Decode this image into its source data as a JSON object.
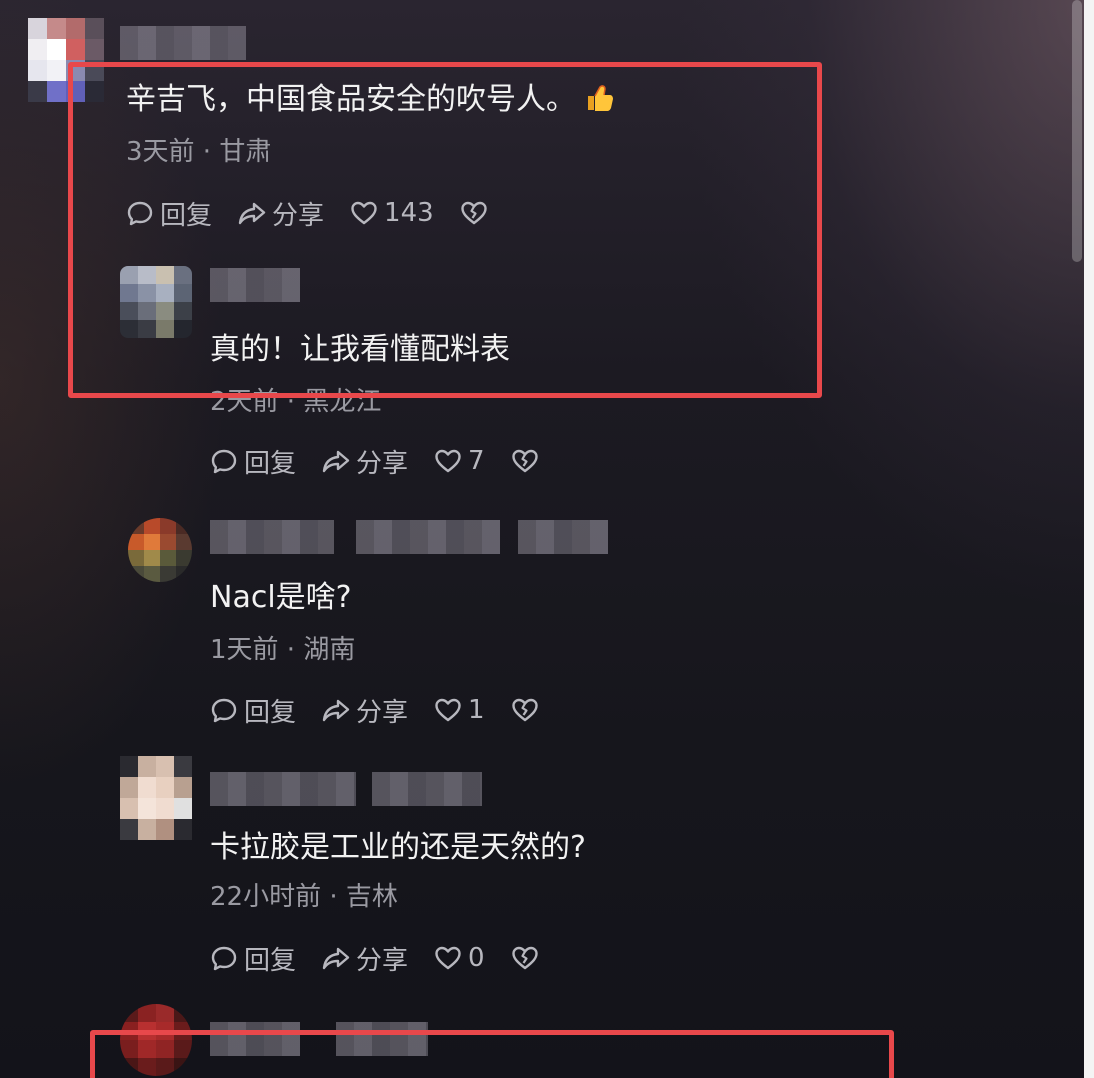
{
  "comments": [
    {
      "text": "辛吉飞，中国食品安全的吹号人。",
      "emoji": "👍",
      "meta": "3天前 · 甘肃",
      "actions": {
        "reply": "回复",
        "share": "分享",
        "likes": "143"
      }
    },
    {
      "text": "真的！让我看懂配料表",
      "meta": "2天前 · 黑龙江",
      "actions": {
        "reply": "回复",
        "share": "分享",
        "likes": "7"
      }
    },
    {
      "text": "Nacl是啥?",
      "meta": "1天前 · 湖南",
      "actions": {
        "reply": "回复",
        "share": "分享",
        "likes": "1"
      }
    },
    {
      "text": "卡拉胶是工业的还是天然的?",
      "meta": "22小时前 · 吉林",
      "actions": {
        "reply": "回复",
        "share": "分享",
        "likes": "0"
      }
    }
  ],
  "colors": {
    "highlight": "#e8484b",
    "text": "#f2f2f2",
    "meta": "#9a9aa2",
    "action": "#b7b7be",
    "background": "#16161c"
  },
  "icons": [
    "reply-bubble-icon",
    "share-arrow-icon",
    "heart-icon",
    "broken-heart-icon",
    "thumbs-up-emoji"
  ]
}
